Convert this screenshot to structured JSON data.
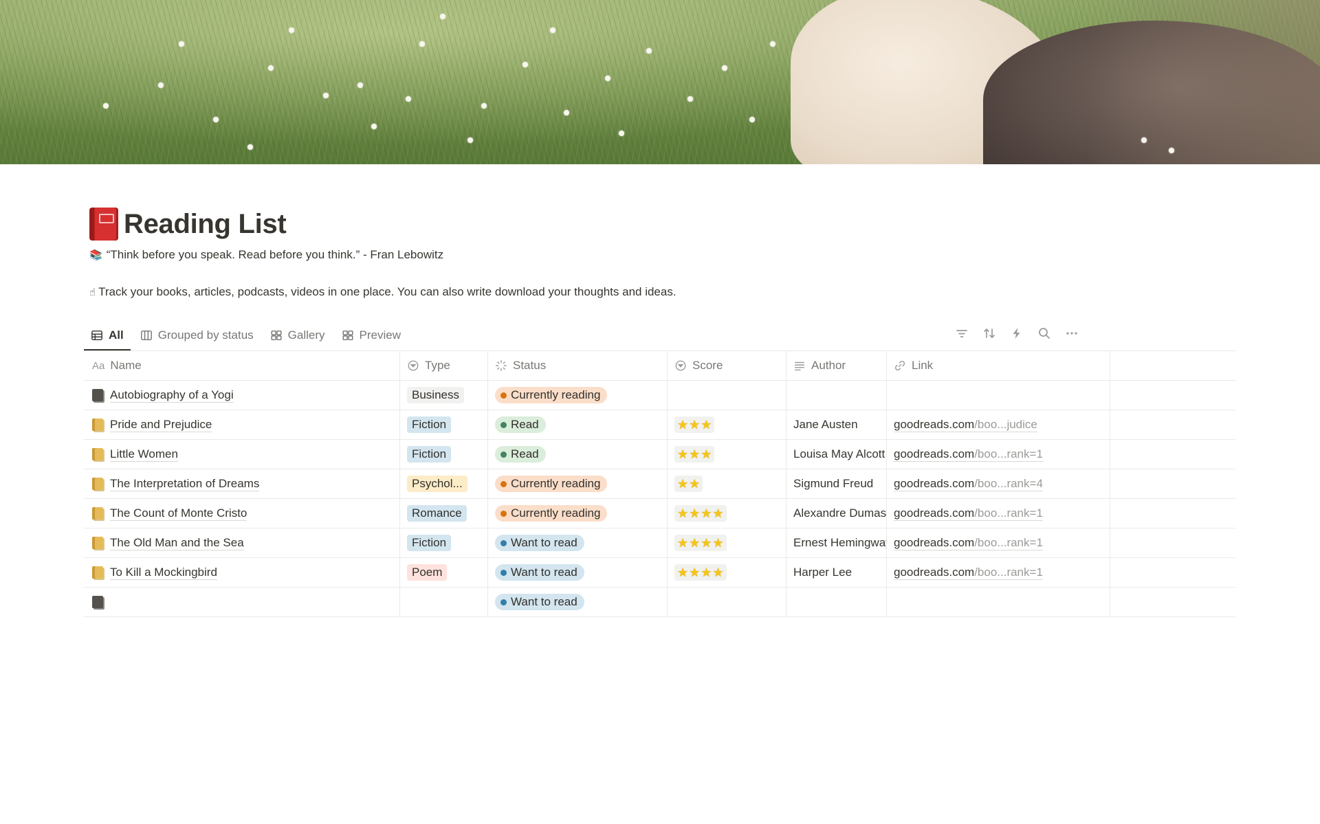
{
  "page": {
    "title": "Reading List",
    "quote": "“Think before you speak. Read before you think.” - Fran Lebowitz",
    "description": "Track your books, articles, podcasts, videos in one place. You can also write download your thoughts and ideas."
  },
  "views": [
    {
      "label": "All",
      "icon": "table-icon",
      "active": true
    },
    {
      "label": "Grouped by status",
      "icon": "board-icon"
    },
    {
      "label": "Gallery",
      "icon": "gallery-icon"
    },
    {
      "label": "Preview",
      "icon": "gallery-icon"
    }
  ],
  "columns": {
    "name": "Name",
    "type": "Type",
    "status": "Status",
    "score": "Score",
    "author": "Author",
    "link": "Link"
  },
  "rows": [
    {
      "name": "Autobiography of a Yogi",
      "icon": "gray",
      "type": "Business",
      "type_color": "gray",
      "status": "Currently reading",
      "status_kind": "current",
      "stars": 0,
      "author": "",
      "link_domain": "",
      "link_path": ""
    },
    {
      "name": "Pride and Prejudice",
      "icon": "gold",
      "type": "Fiction",
      "type_color": "blue",
      "status": "Read",
      "status_kind": "read",
      "stars": 3,
      "author": "Jane Austen",
      "link_domain": "goodreads.com",
      "link_path": "/boo...judice"
    },
    {
      "name": "Little Women",
      "icon": "gold",
      "type": "Fiction",
      "type_color": "blue",
      "status": "Read",
      "status_kind": "read",
      "stars": 3,
      "author": "Louisa May Alcott",
      "link_domain": "goodreads.com",
      "link_path": "/boo...rank=1"
    },
    {
      "name": "The Interpretation of Dreams",
      "icon": "gold",
      "type": "Psychol...",
      "type_color": "yellow",
      "status": "Currently reading",
      "status_kind": "current",
      "stars": 2,
      "author": "Sigmund Freud",
      "link_domain": "goodreads.com",
      "link_path": "/boo...rank=4"
    },
    {
      "name": "The Count of Monte Cristo",
      "icon": "gold",
      "type": "Romance",
      "type_color": "blue",
      "status": "Currently reading",
      "status_kind": "current",
      "stars": 4,
      "author": "Alexandre Dumas",
      "link_domain": "goodreads.com",
      "link_path": "/boo...rank=1"
    },
    {
      "name": "The Old Man and the Sea",
      "icon": "gold",
      "type": "Fiction",
      "type_color": "blue",
      "status": "Want to read",
      "status_kind": "want",
      "stars": 4,
      "author": "Ernest Hemingway",
      "link_domain": "goodreads.com",
      "link_path": "/boo...rank=1"
    },
    {
      "name": "To Kill a Mockingbird",
      "icon": "gold",
      "type": "Poem",
      "type_color": "red",
      "status": "Want to read",
      "status_kind": "want",
      "stars": 4,
      "author": "Harper Lee",
      "link_domain": "goodreads.com",
      "link_path": "/boo...rank=1"
    },
    {
      "name": "",
      "icon": "gray",
      "type": "",
      "type_color": "",
      "status": "Want to read",
      "status_kind": "want",
      "stars": 0,
      "author": "",
      "link_domain": "",
      "link_path": ""
    }
  ],
  "colors": {
    "text": "#37352f",
    "muted": "#787774",
    "current": "#d9730d",
    "read": "#448361",
    "want": "#337ea9"
  }
}
